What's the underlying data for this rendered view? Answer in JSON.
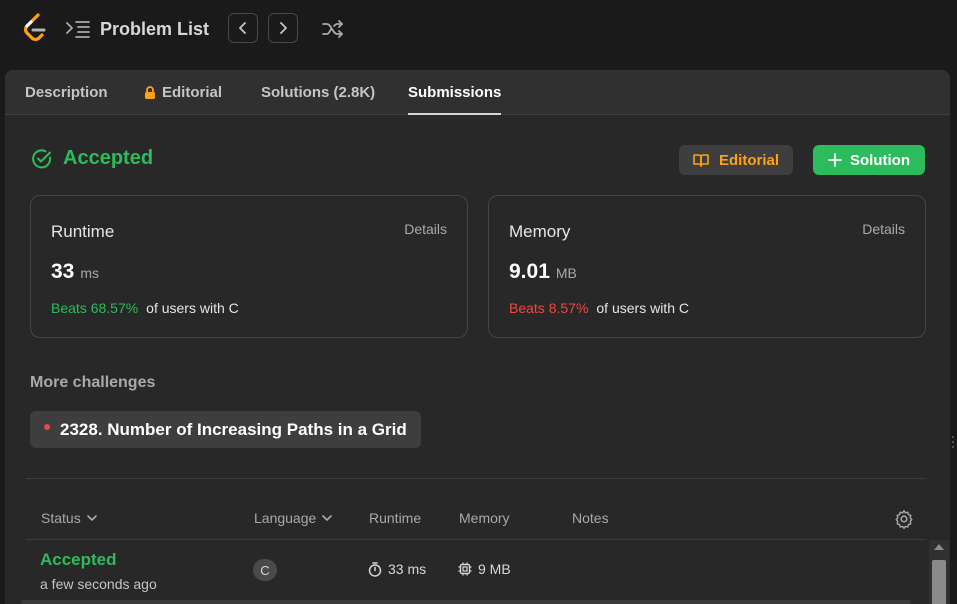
{
  "topbar": {
    "problem_list_label": "Problem List"
  },
  "tabs": [
    {
      "label": "Description"
    },
    {
      "label": "Editorial",
      "locked": true
    },
    {
      "label": "Solutions (2.8K)"
    },
    {
      "label": "Submissions",
      "active": true
    }
  ],
  "result": {
    "status": "Accepted",
    "editorial_button": "Editorial",
    "solution_button": "Solution"
  },
  "runtime": {
    "title": "Runtime",
    "details": "Details",
    "value": "33",
    "unit": "ms",
    "beats": "Beats 68.57%",
    "beats_suffix": "of users with C"
  },
  "memory": {
    "title": "Memory",
    "details": "Details",
    "value": "9.01",
    "unit": "MB",
    "beats": "Beats 8.57%",
    "beats_suffix": "of users with C"
  },
  "more": {
    "title": "More challenges",
    "challenge": "2328. Number of Increasing Paths in a Grid"
  },
  "table": {
    "headers": {
      "status": "Status",
      "language": "Language",
      "runtime": "Runtime",
      "memory": "Memory",
      "notes": "Notes"
    },
    "rows": [
      {
        "status": "Accepted",
        "time": "a few seconds ago",
        "language": "C",
        "runtime": "33 ms",
        "memory": "9 MB"
      }
    ]
  },
  "colors": {
    "accepted": "#2cbb5d",
    "editorial": "#ffa116",
    "beats_low": "#ef4743",
    "background": "#1a1a1a",
    "panel": "#282828"
  }
}
